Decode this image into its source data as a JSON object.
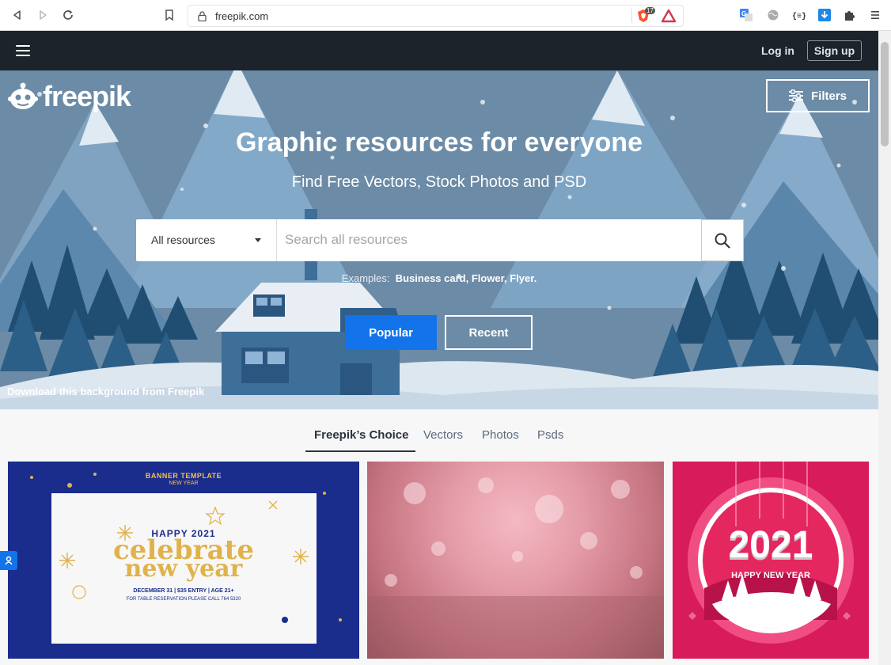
{
  "browser": {
    "url": "freepik.com",
    "badge_count": "17"
  },
  "topbar": {
    "login_label": "Log in",
    "signup_label": "Sign up"
  },
  "hero": {
    "logo_text": "freepik",
    "filters_label": "Filters",
    "title": "Graphic resources for everyone",
    "subtitle": "Find Free Vectors, Stock Photos and PSD",
    "search": {
      "category": "All resources",
      "placeholder": "Search all resources"
    },
    "examples_label": "Examples:",
    "examples_values": "Business card, Flower, Flyer.",
    "popular_label": "Popular",
    "recent_label": "Recent",
    "bg_credit": "Download this background from Freepik"
  },
  "tabs": [
    {
      "label": "Freepik’s Choice",
      "active": true
    },
    {
      "label": "Vectors",
      "active": false
    },
    {
      "label": "Photos",
      "active": false
    },
    {
      "label": "Psds",
      "active": false
    }
  ],
  "cards": {
    "banner": {
      "header": "BANNER TEMPLATE",
      "header_sub": "NEW YEAR",
      "happy": "HAPPY 2021",
      "celebrate": "celebrate",
      "new_year": "new year",
      "details": "DECEMBER 31 | $35 ENTRY | AGE 21+",
      "reservation": "FOR TABLE RESERVATION PLEASE CALL 764 5320"
    },
    "ny2021": {
      "year": "2021",
      "caption": "HAPPY NEW YEAR"
    }
  },
  "colors": {
    "accent": "#1273eb",
    "topbar": "#1d232b",
    "banner_bg": "#1a2c8c",
    "pink_bg": "#d81b5a"
  }
}
